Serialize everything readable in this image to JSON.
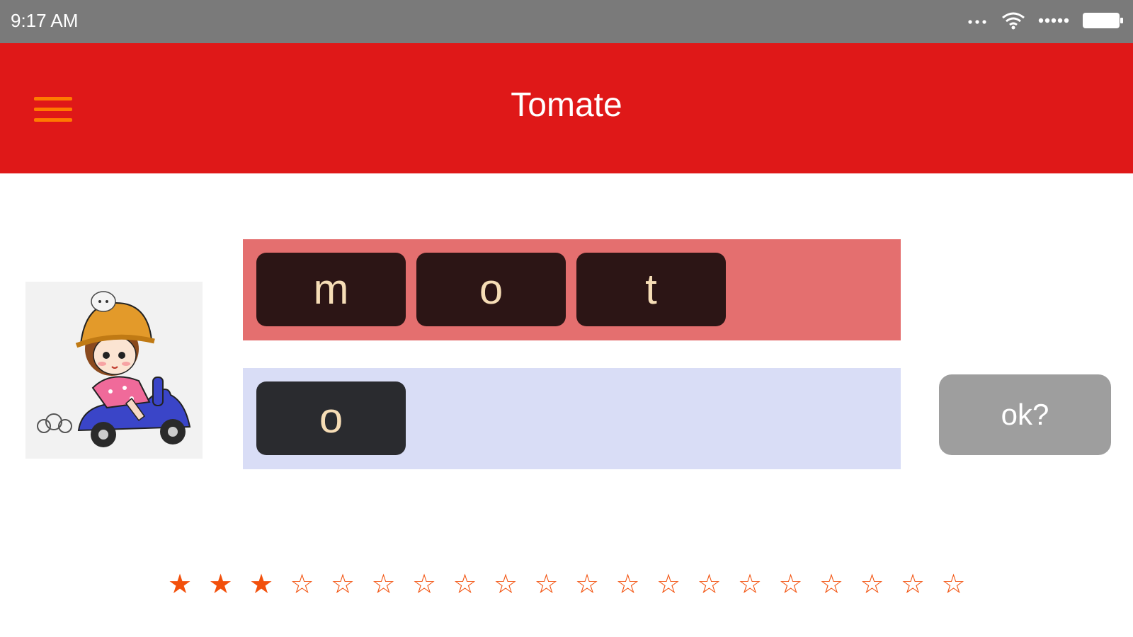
{
  "status_bar": {
    "time": "9:17 AM",
    "icons": [
      "more-dots-icon",
      "wifi-icon",
      "signal-icon",
      "battery-icon"
    ]
  },
  "app_bar": {
    "title": "Tomate",
    "menu_icon": "hamburger-menu-icon"
  },
  "picture": {
    "icon": "girl-on-scooter-illustration"
  },
  "answer_letters": [
    "m",
    "o",
    "t"
  ],
  "pool_letters": [
    "o"
  ],
  "ok_button": {
    "label": "ok?"
  },
  "stars": {
    "filled": 3,
    "total": 20
  },
  "colors": {
    "status_bar": "#7a7a7a",
    "app_bar": "#df1818",
    "menu_icon": "#ff7a00",
    "answer_row": "#e46f6f",
    "pool_row": "#d9ddf6",
    "tile": "#2c1515",
    "tile_text": "#f6ddb6",
    "ok_button": "#9e9e9e",
    "star": "#f2500c"
  }
}
